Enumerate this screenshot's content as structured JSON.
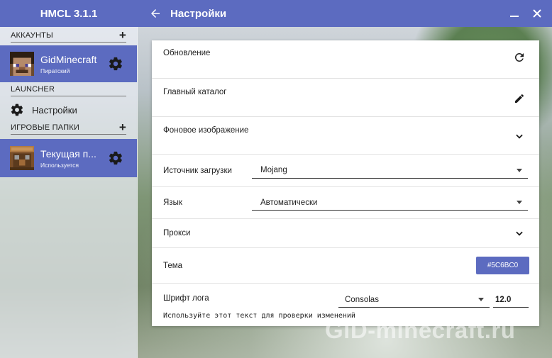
{
  "app": {
    "title": "HMCL 3.1.1"
  },
  "header": {
    "page_title": "Настройки"
  },
  "sidebar": {
    "accounts_header": "АККАУНТЫ",
    "account": {
      "name": "GidMinecraft",
      "type": "Пиратский"
    },
    "launcher_header": "LAUNCHER",
    "settings_label": "Настройки",
    "folders_header": "ИГРОВЫЕ ПАПКИ",
    "folder": {
      "name": "Текущая п...",
      "status": "Используется"
    }
  },
  "settings": {
    "update_label": "Обновление",
    "main_dir_label": "Главный каталог",
    "background_label": "Фоновое изображение",
    "download_source_label": "Источник загрузки",
    "download_source_value": "Mojang",
    "language_label": "Язык",
    "language_value": "Автоматически",
    "proxy_label": "Прокси",
    "theme_label": "Тема",
    "theme_value": "#5C6BC0",
    "log_font_label": "Шрифт лога",
    "log_font_value": "Consolas",
    "log_font_size": "12.0",
    "log_font_preview": "Используйте этот текст для проверки изменений"
  },
  "watermark": "GiD-minecraft.ru",
  "colors": {
    "accent": "#5c6bc0"
  },
  "icons": [
    "back-arrow-icon",
    "minimize-icon",
    "close-icon",
    "plus-icon",
    "gear-icon",
    "refresh-icon",
    "pencil-icon",
    "chevron-down-icon"
  ]
}
